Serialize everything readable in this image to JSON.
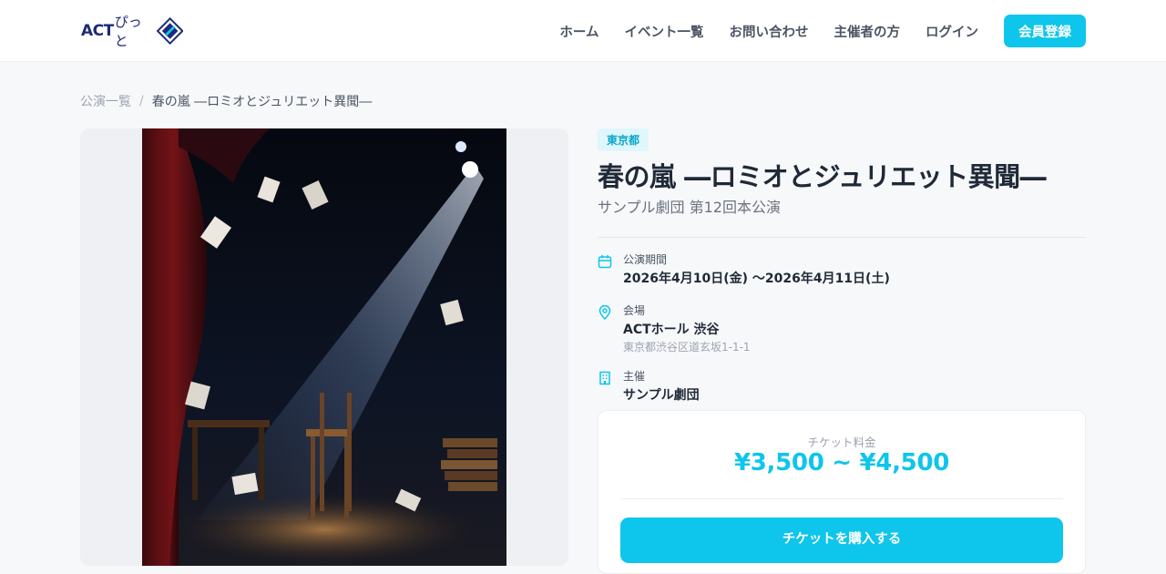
{
  "header": {
    "logo_text": "ACT",
    "logo_kana": "ぴっと",
    "nav": [
      "ホーム",
      "イベント一覧",
      "お問い合わせ",
      "主催者の方",
      "ログイン"
    ],
    "cta_label": "会員登録"
  },
  "breadcrumb": {
    "parent": "公演一覧",
    "separator": "/",
    "current": "春の嵐 ―ロミオとジュリエット異聞―"
  },
  "event": {
    "prefecture_tag": "東京都",
    "title": "春の嵐 ―ロミオとジュリエット異聞―",
    "subtitle": "サンプル劇団 第12回本公演",
    "period_label": "公演期間",
    "period_value": "2026年4月10日(金) ～2026年4月11日(土)",
    "venue_label": "会場",
    "venue_name": "ACTホール 渋谷",
    "venue_address": "東京都渋谷区道玄坂1-1-1",
    "organizer_label": "主催",
    "organizer_name": "サンプル劇団"
  },
  "ticket": {
    "label": "チケット料金",
    "price_range": "¥3,500 ~ ¥4,500",
    "buy_label": "チケットを購入する"
  },
  "colors": {
    "accent": "#0ec5eb",
    "brand": "#1e2a78"
  }
}
